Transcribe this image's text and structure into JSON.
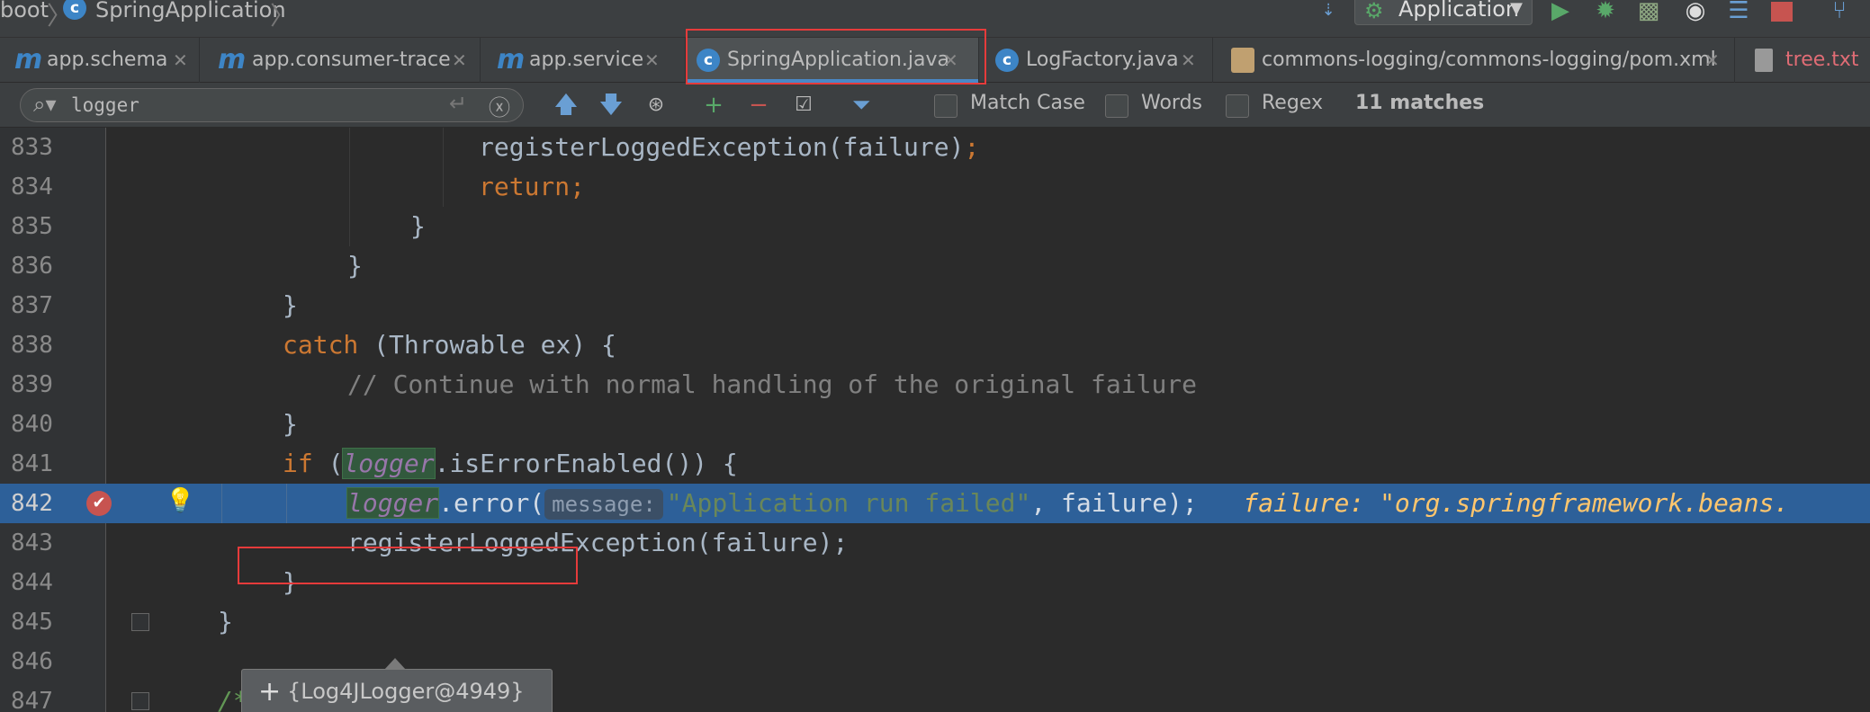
{
  "navbar": {
    "crumb_root": "boot",
    "crumb_file": "SpringApplication",
    "run_config": "Application",
    "accent_colors": {
      "run": "#59a869",
      "stop": "#c75450",
      "debug": "#59a869"
    }
  },
  "tabs": [
    {
      "label": "app.schema",
      "icon": "maven-icon",
      "active": false
    },
    {
      "label": "app.consumer-trace",
      "icon": "maven-icon",
      "active": false
    },
    {
      "label": "app.service",
      "icon": "maven-icon",
      "active": false
    },
    {
      "label": "SpringApplication.java",
      "icon": "java-class-icon",
      "active": true
    },
    {
      "label": "LogFactory.java",
      "icon": "java-class-icon",
      "active": false
    },
    {
      "label": "commons-logging/commons-logging/pom.xml",
      "icon": "xml-icon",
      "active": false
    },
    {
      "label": "tree.txt",
      "icon": "text-file-icon",
      "active": false
    }
  ],
  "search": {
    "query": "logger",
    "match_case_label": "Match Case",
    "words_label": "Words",
    "regex_label": "Regex",
    "match_count": "11 matches"
  },
  "editor": {
    "lines": [
      {
        "num": "833"
      },
      {
        "num": "834"
      },
      {
        "num": "835"
      },
      {
        "num": "836"
      },
      {
        "num": "837"
      },
      {
        "num": "838"
      },
      {
        "num": "839"
      },
      {
        "num": "840"
      },
      {
        "num": "841"
      },
      {
        "num": "842"
      },
      {
        "num": "843"
      },
      {
        "num": "844"
      },
      {
        "num": "845"
      },
      {
        "num": "846"
      },
      {
        "num": "847"
      }
    ],
    "code": {
      "l833_fn": "registerLoggedException(failure)",
      "l834_kw": "return;",
      "l838_kw": "catch",
      "l838_rest": " (Throwable ex) {",
      "l839_comment": "// Continue with normal handling of the original failure",
      "l841_kw": "if",
      "l841_var": "logger",
      "l841_rest": ".isErrorEnabled()) {",
      "l842_var": "logger",
      "l842_call": ".error(",
      "l842_hint": "message:",
      "l842_str": "\"Application run failed\"",
      "l842_rest": ", failure);",
      "l842_inline": "failure: \"org.springframework.beans.",
      "l843_text": "registerLoggedException(failure);",
      "l847_doc": "/**"
    },
    "popup_value": "{Log4JLogger@4949}"
  }
}
